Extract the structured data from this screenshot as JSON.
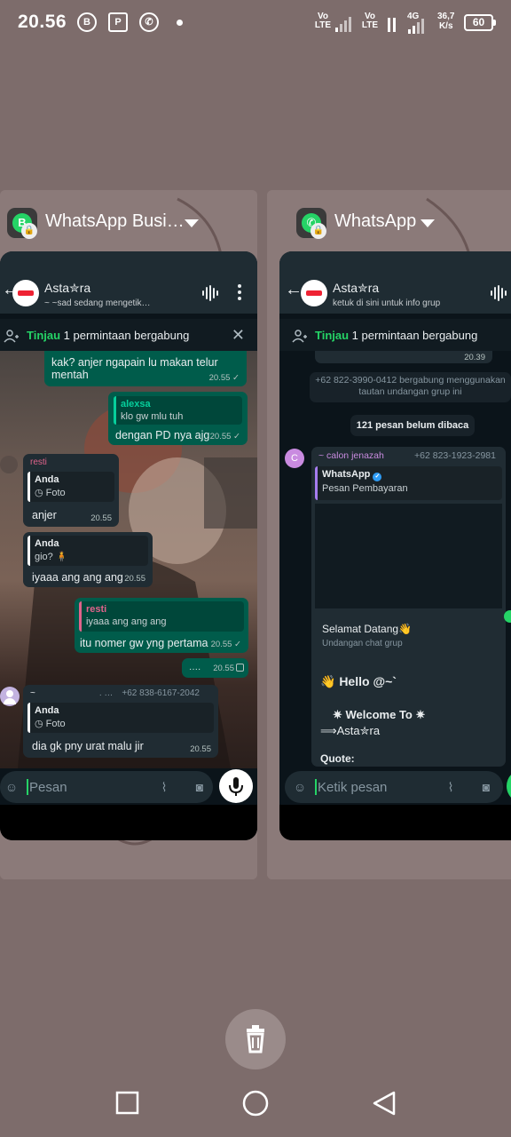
{
  "status_bar": {
    "time": "20.56",
    "notif_icons": [
      "b-icon",
      "pdf-reader-icon",
      "whatsapp-icon"
    ],
    "volte1": "Vo LTE",
    "volte2": "Vo LTE",
    "network": "4G",
    "speed_value": "36,7",
    "speed_unit": "K/s",
    "battery": "60"
  },
  "cards": [
    {
      "app_name": "WhatsApp Busi…",
      "chat_title": "Asta✮ra",
      "chat_subtitle": "~ ~sad sedang mengetik…",
      "join_review": "Tinjau",
      "join_text": "1 permintaan bergabung",
      "messages": [
        {
          "type": "out",
          "text": "kak? anjer ngapain lu makan telur mentah",
          "time": "20.55 ✓"
        },
        {
          "type": "out",
          "quote_name": "alexsa",
          "quote_text": "klo gw mlu tuh",
          "text": "dengan PD nya ajg",
          "time": "20.55 ✓"
        },
        {
          "type": "in",
          "sender": "resti",
          "quote_name": "Anda",
          "quote_text": "Foto",
          "text": "anjer",
          "time": "20.55"
        },
        {
          "type": "in",
          "quote_name": "Anda",
          "quote_text": "gio? 🧍",
          "text": "iyaaa ang ang ang",
          "time": "20.55"
        },
        {
          "type": "out",
          "quote_name": "resti",
          "quote_text": "iyaaa ang ang ang",
          "text": "itu nomer gw yng pertama",
          "time": "20.55 ✓"
        },
        {
          "type": "out",
          "text": "····",
          "time": "20.55"
        },
        {
          "type": "in",
          "sender": "~",
          "sender_extra": ". …",
          "phone": "+62 838-6167-2042",
          "quote_name": "Anda",
          "quote_text": "Foto",
          "text": "dia gk pny urat malu jir",
          "time": "20.55"
        }
      ],
      "composer_placeholder": "Pesan"
    },
    {
      "app_name": "WhatsApp",
      "chat_title": "Asta✮ra",
      "chat_subtitle": "ketuk di sini untuk info grup",
      "join_review": "Tinjau",
      "join_text": "1 permintaan bergabung",
      "msg_time_top": "20.39",
      "system_msg": "+62 822-3990-0412 bergabung menggunakan tautan undangan grup ini",
      "unread_label": "121 pesan belum dibaca",
      "sender_initial": "C",
      "sender": "~ calon jenazah",
      "phone": "+62 823-1923-2981",
      "quote_name": "WhatsApp",
      "quote_text": "Pesan Pembayaran",
      "welcome_title": "Selamat Datang👋",
      "welcome_sub": "Undangan chat grup",
      "hello": "👋 Hello @~`",
      "welcome_line": "✷ Welcome To ✷",
      "name_line": "⟹Asta✮ra",
      "quote_label": "Quote:",
      "composer_placeholder": "Ketik pesan"
    }
  ],
  "colors": {
    "background": "#7d6c6b",
    "chat_bg": "#0b141a",
    "header_bg": "#1f2c33",
    "outgoing_bubble": "#005c4b",
    "incoming_bubble": "#202c33",
    "accent_green": "#25d366"
  }
}
